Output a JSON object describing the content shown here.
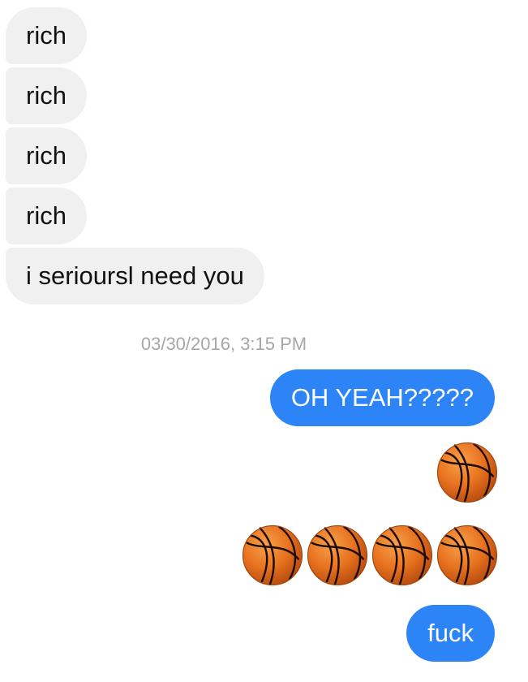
{
  "incoming_messages": [
    {
      "text": "rich"
    },
    {
      "text": "rich"
    },
    {
      "text": "rich"
    },
    {
      "text": "rich"
    },
    {
      "text": "i serioursl need you"
    }
  ],
  "timestamp": "03/30/2016, 3:15 PM",
  "outgoing_messages": [
    {
      "text": "OH YEAH?????"
    },
    {
      "emoji": "basketball",
      "count": 1
    },
    {
      "emoji": "basketball",
      "count": 4
    },
    {
      "text": "fuck"
    }
  ],
  "colors": {
    "incoming_bubble": "#f1f0f0",
    "outgoing_bubble": "#2c84f7",
    "timestamp_text": "#a7a7a7",
    "basketball": "#e8731f"
  }
}
